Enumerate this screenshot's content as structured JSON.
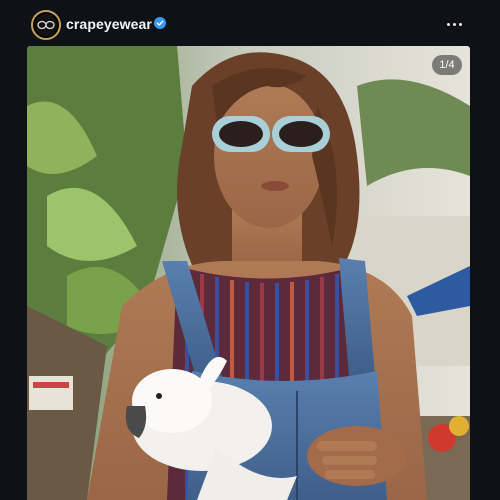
{
  "post": {
    "username": "crapeyewear",
    "verified": true,
    "carousel_counter": "1/4",
    "icons": {
      "avatar": "brand-logo-avatar",
      "verified": "verified-badge-icon",
      "more": "more-options-icon"
    }
  },
  "colors": {
    "background": "#0e1116",
    "verified_badge": "#3897f0",
    "avatar_ring": "#c7a15a"
  }
}
